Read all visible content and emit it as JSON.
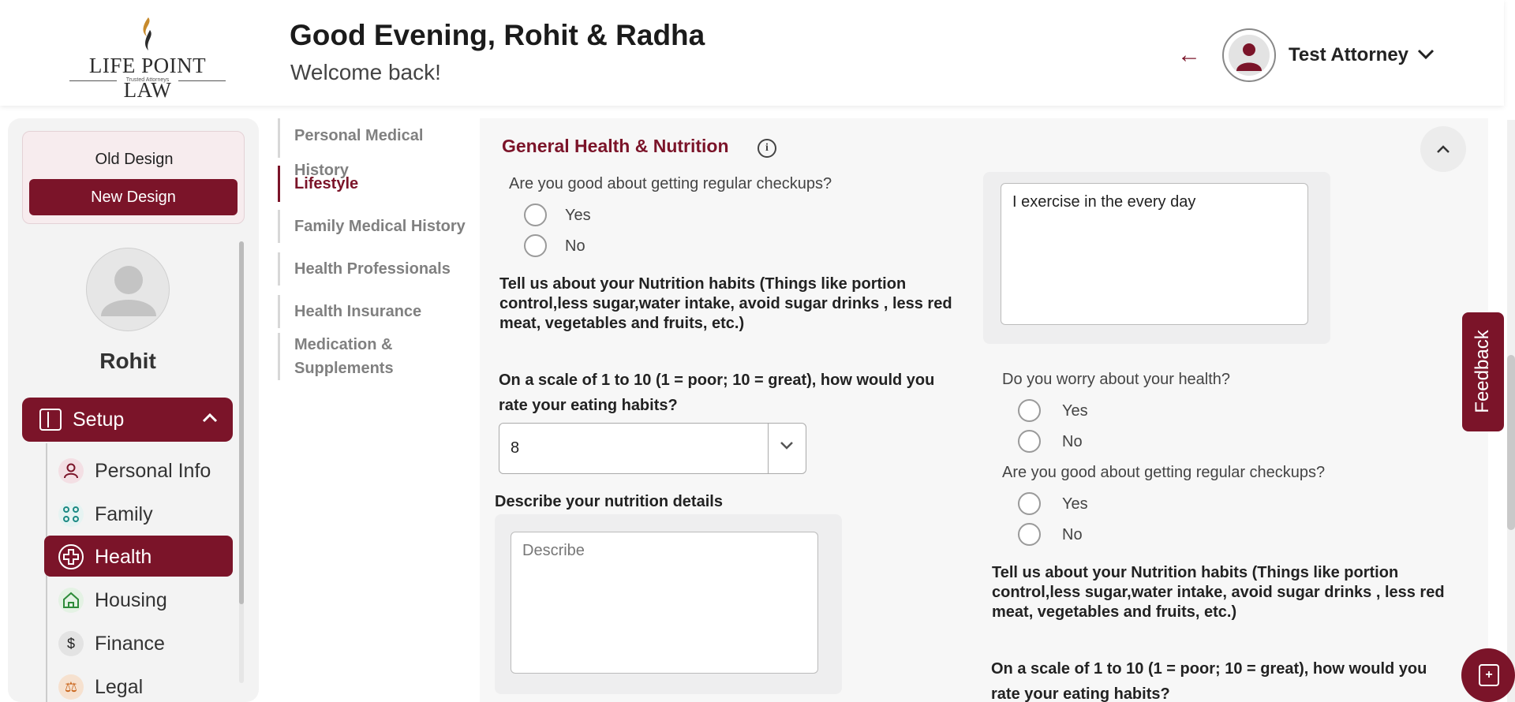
{
  "brand": {
    "name": "LIFE POINT LAW",
    "tagline": "Trusted Attorneys"
  },
  "header": {
    "greeting": "Good Evening, Rohit & Radha",
    "subtitle": "Welcome back!",
    "back_icon": "arrow-left-icon",
    "user_name": "Test Attorney"
  },
  "design_toggle": {
    "old": "Old Design",
    "new": "New Design"
  },
  "profile": {
    "name": "Rohit"
  },
  "sidebar": {
    "setup_label": "Setup",
    "items": [
      {
        "label": "Personal Info",
        "icon": "person-icon"
      },
      {
        "label": "Family",
        "icon": "family-icon"
      },
      {
        "label": "Health",
        "icon": "health-cross-icon"
      },
      {
        "label": "Housing",
        "icon": "home-icon"
      },
      {
        "label": "Finance",
        "icon": "dollar-icon"
      },
      {
        "label": "Legal",
        "icon": "legal-icon"
      }
    ],
    "active": "Health"
  },
  "subnav": {
    "items": [
      "Personal Medical History",
      "Lifestyle",
      "Family Medical History",
      "Health Professionals",
      "Health Insurance",
      "Medication & Supplements"
    ],
    "active": "Lifestyle"
  },
  "section": {
    "title": "General Health & Nutrition",
    "left": {
      "q_checkups": "Are you good about getting regular checkups?",
      "yes": "Yes",
      "no": "No",
      "nutrition_prompt": "Tell us about your Nutrition habits (Things like portion control,less sugar,water intake, avoid sugar drinks , less red meat, vegetables and fruits, etc.)",
      "scale_q": "On a scale of 1 to 10 (1 = poor; 10 = great), how would you rate your eating habits?",
      "scale_value": "8",
      "describe_label": "Describe your nutrition details",
      "describe_placeholder": "Describe"
    },
    "right": {
      "exercise_text": "I exercise in the every day",
      "q_worry": "Do you worry about your health?",
      "q_checkups": "Are you good about getting regular checkups?",
      "yes": "Yes",
      "no": "No",
      "nutrition_prompt": "Tell us about your Nutrition habits (Things like portion control,less sugar,water intake, avoid sugar drinks , less red meat, vegetables and fruits, etc.)",
      "scale_q": "On a scale of 1 to 10 (1 = poor; 10 = great), how would you rate your eating habits?"
    }
  },
  "feedback_label": "Feedback",
  "colors": {
    "brand": "#7b1429",
    "panel": "#f7f7f7"
  }
}
